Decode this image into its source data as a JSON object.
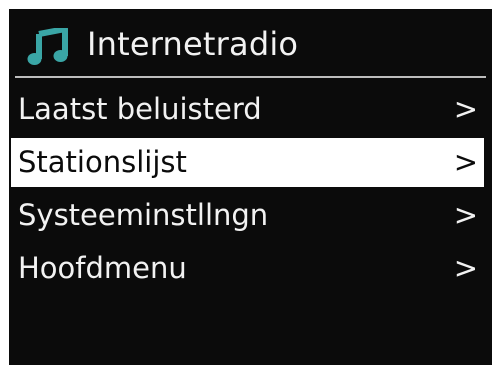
{
  "header": {
    "icon": "music-note-icon",
    "title": "Internetradio"
  },
  "colors": {
    "background": "#0b0b0b",
    "text": "#f2f2f2",
    "icon": "#3aa6a6",
    "selected_bg": "#ffffff",
    "selected_text": "#0b0b0b"
  },
  "menu": {
    "items": [
      {
        "label": "Laatst beluisterd",
        "chevron": ">",
        "selected": false
      },
      {
        "label": "Stationslijst",
        "chevron": ">",
        "selected": true
      },
      {
        "label": "Systeeminstllngn",
        "chevron": ">",
        "selected": false
      },
      {
        "label": "Hoofdmenu",
        "chevron": ">",
        "selected": false
      }
    ]
  }
}
